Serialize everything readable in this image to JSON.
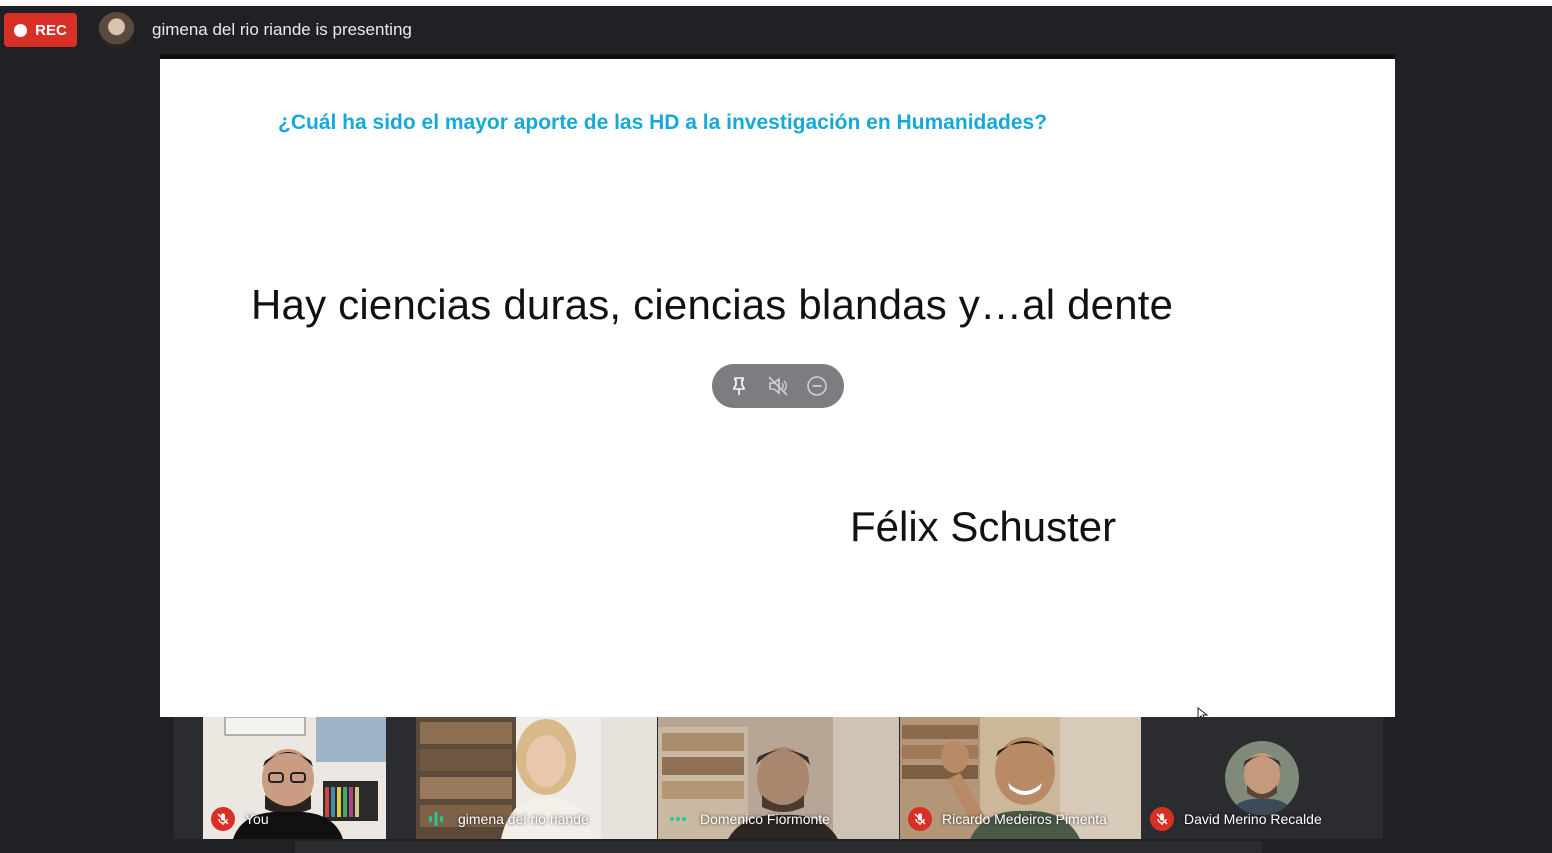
{
  "recording": {
    "label": "REC"
  },
  "presenter": {
    "text": "gimena del rio riande is presenting"
  },
  "slide": {
    "question": "¿Cuál ha sido el mayor aporte de las HD a la investigación en Humanidades?",
    "quote": "Hay ciencias duras, ciencias blandas y…al dente",
    "author": "Félix Schuster"
  },
  "overlay": {
    "icons": [
      "pin-icon",
      "mute-icon",
      "remove-icon"
    ]
  },
  "participants": [
    {
      "name": "You",
      "mic": "muted"
    },
    {
      "name": "gimena del rio riande",
      "mic": "speaking"
    },
    {
      "name": "Domenico Fiormonte",
      "mic": "active"
    },
    {
      "name": "Ricardo Medeiros Pimenta",
      "mic": "muted"
    },
    {
      "name": "David Merino Recalde",
      "mic": "muted"
    }
  ],
  "colors": {
    "rec": "#d93025",
    "question": "#18a8d8",
    "speaking": "#20c997"
  }
}
